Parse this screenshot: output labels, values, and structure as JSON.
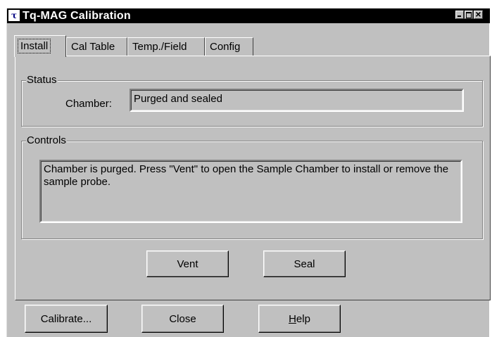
{
  "window": {
    "title": "Tq-MAG Calibration",
    "app_icon_glyph": "τ",
    "buttons": [
      "minimize-icon",
      "maximize-icon",
      "close-icon"
    ]
  },
  "tabs": [
    {
      "label": "Install",
      "active": true
    },
    {
      "label": "Cal Table",
      "active": false
    },
    {
      "label": "Temp./Field",
      "active": false
    },
    {
      "label": "Config",
      "active": false
    }
  ],
  "status": {
    "group_label": "Status",
    "chamber_label": "Chamber:",
    "chamber_value": "Purged and sealed"
  },
  "controls": {
    "group_label": "Controls",
    "message": "Chamber is purged.  Press \"Vent\" to open the Sample Chamber to install or remove the sample probe.",
    "vent_label": "Vent",
    "seal_label": "Seal"
  },
  "footer": {
    "calibrate_label": "Calibrate...",
    "close_label": "Close",
    "help_label": "Help"
  },
  "colors": {
    "face": "#c0c0c0",
    "titlebar": "#000000"
  }
}
